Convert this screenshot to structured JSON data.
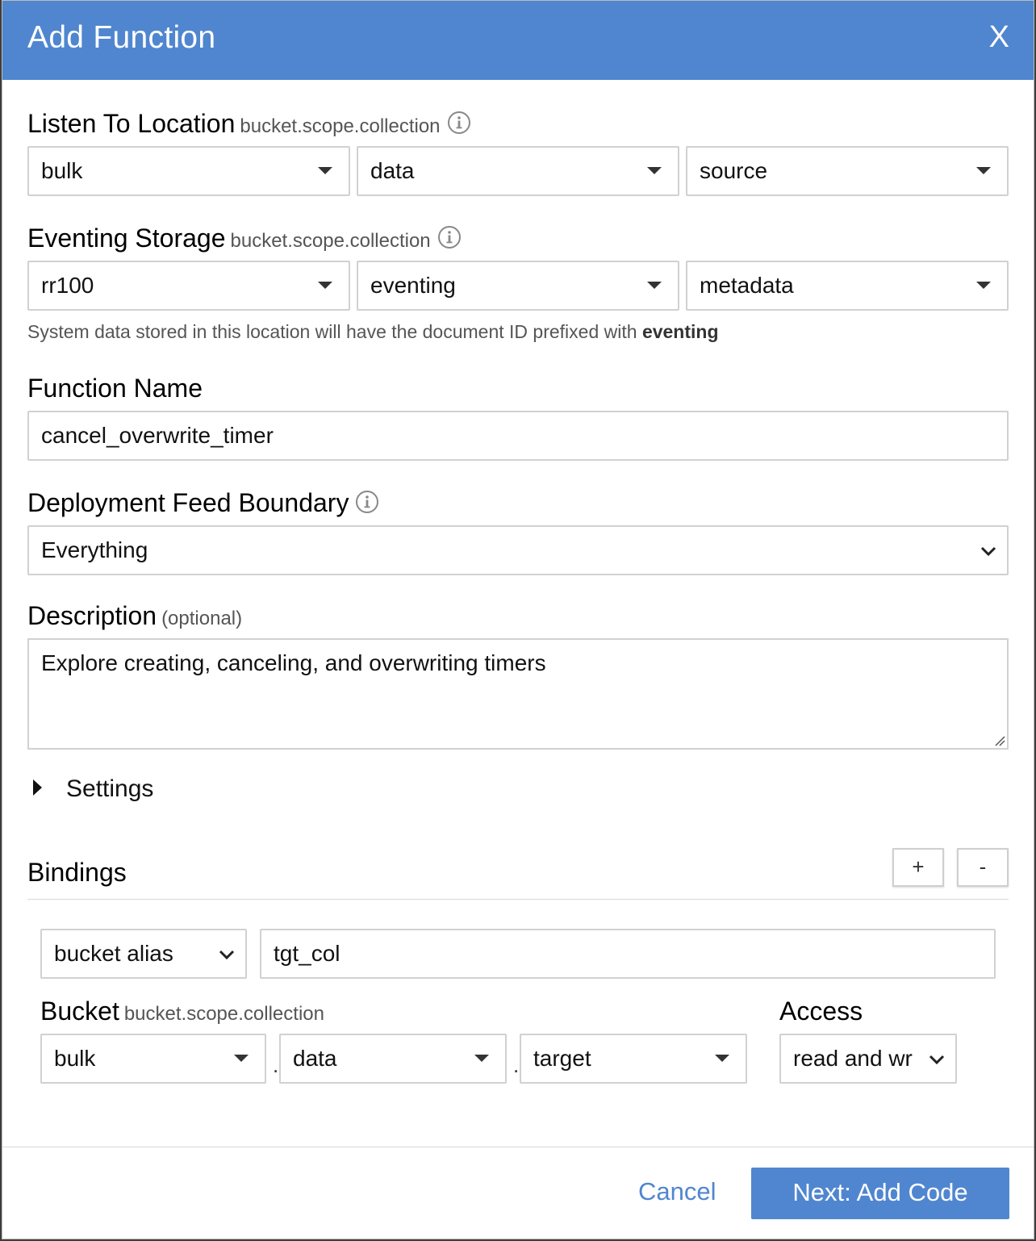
{
  "dialog": {
    "title": "Add Function",
    "close": "X"
  },
  "listen_to": {
    "label": "Listen To Location",
    "hint": "bucket.scope.collection",
    "bucket": "bulk",
    "scope": "data",
    "collection": "source"
  },
  "eventing_storage": {
    "label": "Eventing Storage",
    "hint": "bucket.scope.collection",
    "bucket": "rr100",
    "scope": "eventing",
    "collection": "metadata",
    "note_prefix": "System data stored in this location will have the document ID prefixed with",
    "note_bold": "eventing"
  },
  "function_name": {
    "label": "Function Name",
    "value": "cancel_overwrite_timer"
  },
  "feed_boundary": {
    "label": "Deployment Feed Boundary",
    "value": "Everything"
  },
  "description": {
    "label": "Description",
    "hint": "(optional)",
    "value": "Explore creating, canceling, and overwriting timers"
  },
  "settings": {
    "label": "Settings"
  },
  "bindings": {
    "label": "Bindings",
    "add": "+",
    "remove": "-",
    "type": "bucket alias",
    "alias": "tgt_col",
    "bucket_label": "Bucket",
    "bucket_hint": "bucket.scope.collection",
    "bucket": "bulk",
    "scope": "data",
    "collection": "target",
    "access_label": "Access",
    "access": "read and wr",
    "separator": "."
  },
  "footer": {
    "cancel": "Cancel",
    "next": "Next: Add Code"
  },
  "colors": {
    "accent": "#5086cf"
  }
}
